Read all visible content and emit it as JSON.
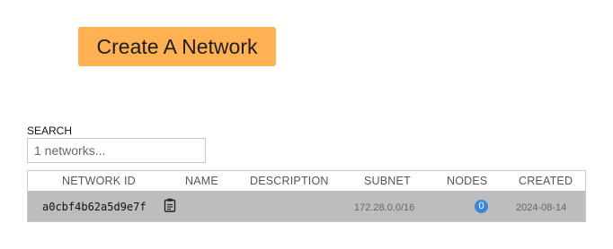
{
  "actions": {
    "create_label": "Create A Network"
  },
  "search": {
    "label": "SEARCH",
    "placeholder": "1 networks..."
  },
  "table": {
    "columns": {
      "network_id": "NETWORK ID",
      "name": "NAME",
      "description": "DESCRIPTION",
      "subnet": "SUBNET",
      "nodes": "NODES",
      "created": "CREATED"
    },
    "rows": [
      {
        "network_id": "a0cbf4b62a5d9e7f",
        "name": "",
        "description": "",
        "subnet": "172.28.0.0/16",
        "nodes": "0",
        "created": "2024-08-14",
        "copy_icon": "clipboard-icon"
      }
    ]
  },
  "colors": {
    "create_button": "#ffb154",
    "row_background": "#bdbdbd",
    "badge": "#3b86d6"
  }
}
